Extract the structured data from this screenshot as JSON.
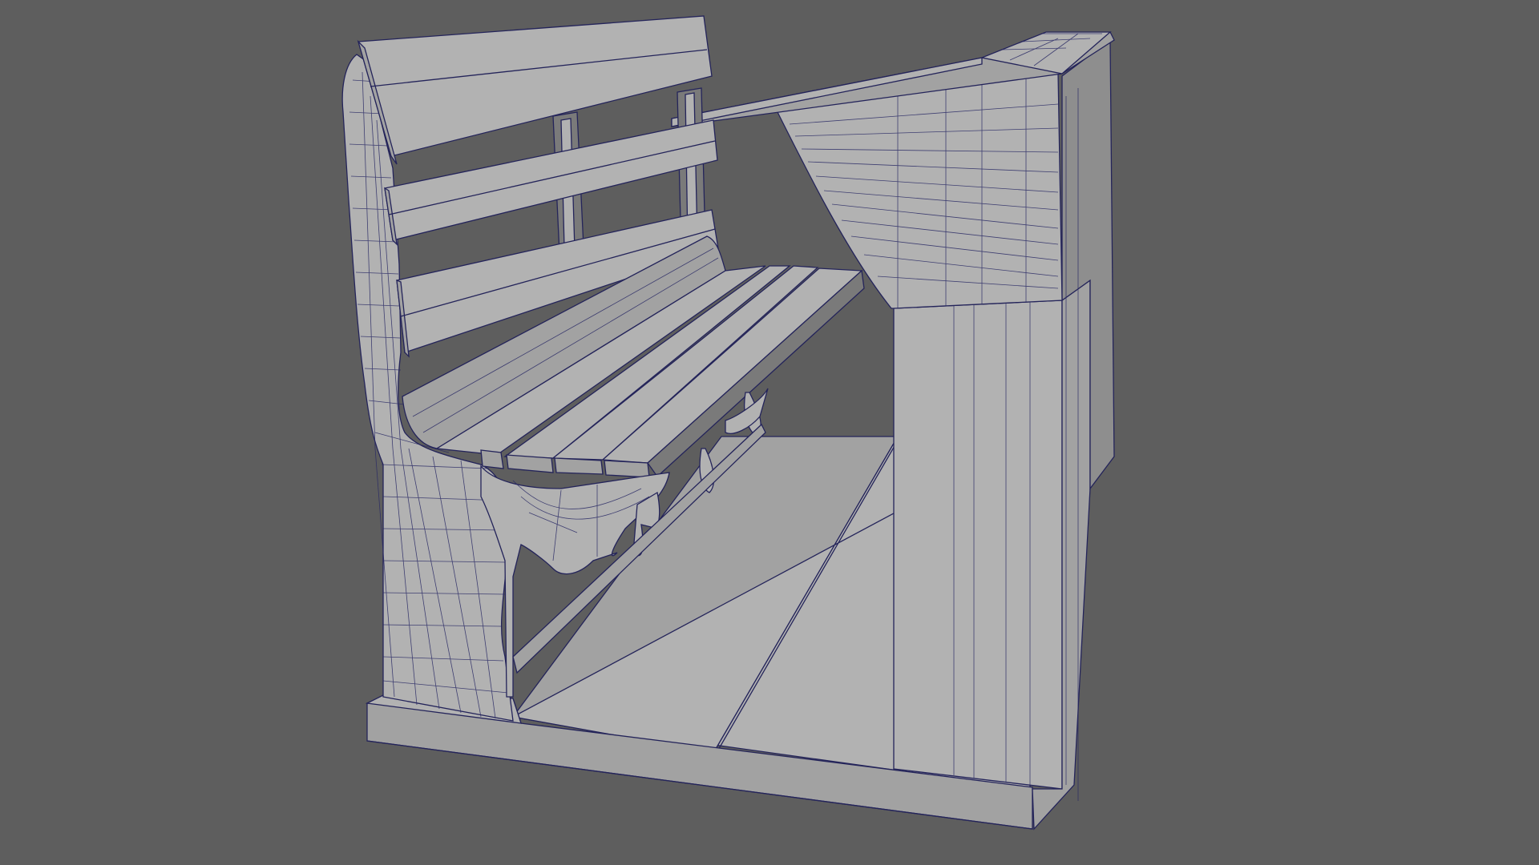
{
  "viewport": {
    "background_color": "#5e5e5e",
    "shading": {
      "light_face": "#b2b2b2",
      "mid_face": "#a2a2a2",
      "dark_face": "#8e8e8e",
      "shadow_face": "#7a7a7a",
      "wireframe_edge": "#24245a"
    }
  },
  "scene": {
    "objects": [
      "bench-model",
      "seat-slats",
      "backrest-slats",
      "end-frame",
      "floor-platform",
      "canopy-roof",
      "side-wall"
    ]
  }
}
